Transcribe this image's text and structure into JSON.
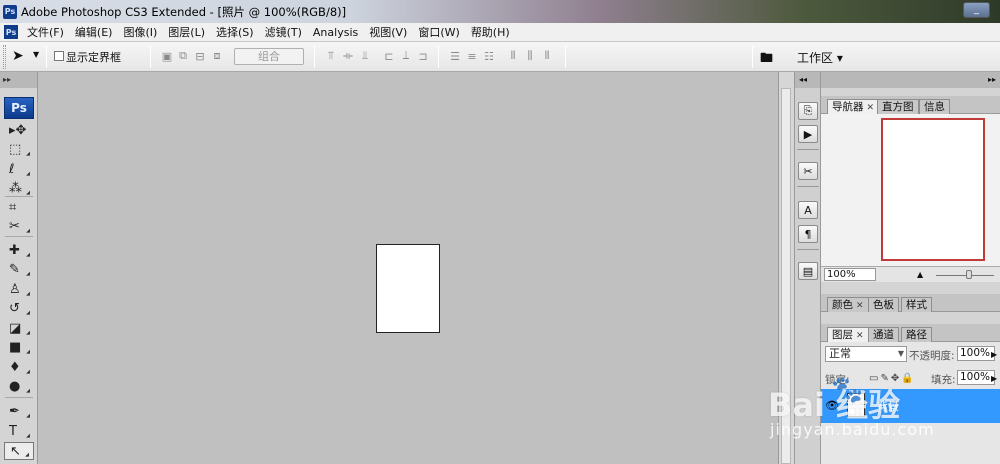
{
  "window": {
    "title": "Adobe Photoshop CS3 Extended - [照片 @ 100%(RGB/8)]",
    "app_icon": "ps-icon",
    "minimize_label": "_"
  },
  "menubar": {
    "items": [
      "文件(F)",
      "编辑(E)",
      "图像(I)",
      "图层(L)",
      "选择(S)",
      "滤镜(T)",
      "Analysis",
      "视图(V)",
      "窗口(W)",
      "帮助(H)"
    ]
  },
  "options": {
    "show_bounds_label": "显示定界框",
    "group_label": "组合",
    "workspace_label": "工作区 ▾"
  },
  "toolbox": {
    "logo": "Ps",
    "tools": [
      {
        "name": "move-tool",
        "glyph": "▸✥"
      },
      {
        "name": "marquee-tool",
        "glyph": "⬚"
      },
      {
        "name": "lasso-tool",
        "glyph": "ℓ"
      },
      {
        "name": "magic-wand-tool",
        "glyph": "⁂"
      },
      {
        "name": "crop-tool",
        "glyph": "⌗"
      },
      {
        "name": "slice-tool",
        "glyph": "✂"
      },
      {
        "name": "healing-brush-tool",
        "glyph": "✚"
      },
      {
        "name": "brush-tool",
        "glyph": "✎"
      },
      {
        "name": "clone-stamp-tool",
        "glyph": "♙"
      },
      {
        "name": "history-brush-tool",
        "glyph": "↺"
      },
      {
        "name": "eraser-tool",
        "glyph": "◪"
      },
      {
        "name": "gradient-tool",
        "glyph": "■"
      },
      {
        "name": "blur-tool",
        "glyph": "💧"
      },
      {
        "name": "dodge-tool",
        "glyph": "●"
      },
      {
        "name": "pen-tool",
        "glyph": "✒"
      },
      {
        "name": "type-tool",
        "glyph": "T"
      },
      {
        "name": "path-selection-tool",
        "glyph": "↖"
      }
    ]
  },
  "panels": {
    "navigator_tabs": [
      "导航器",
      "直方图",
      "信息"
    ],
    "zoom_value": "100%",
    "color_tabs": [
      "颜色",
      "色板",
      "样式"
    ],
    "layers_tabs": [
      "图层",
      "通道",
      "路径"
    ],
    "blend_mode": "正常",
    "opacity_label": "不透明度:",
    "opacity_value": "100%",
    "lock_label": "锁定:",
    "fill_label": "填充:",
    "fill_value": "100%",
    "layer_name": "背景"
  },
  "dock": {
    "buttons": [
      "history-icon",
      "actions-icon",
      "tools-preset-icon",
      "character-icon",
      "paragraph-icon",
      "layer-comps-icon"
    ]
  },
  "watermark": {
    "logo": "Bai  经验",
    "url": "jingyan.baidu.com"
  },
  "colors": {
    "canvas_bg": "#c0c0c0",
    "selection": "#3399ff",
    "nav_frame": "#c03a3a"
  }
}
